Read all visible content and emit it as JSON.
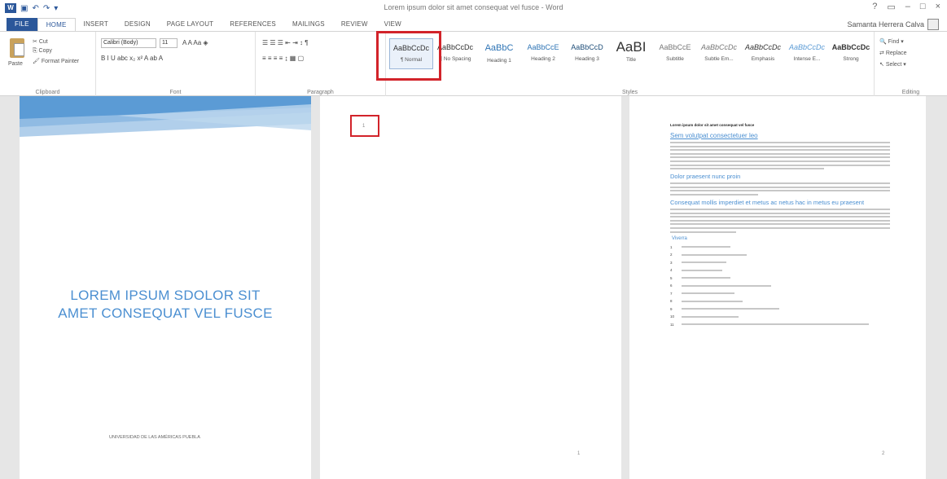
{
  "window": {
    "title": "Lorem ipsum dolor sit amet consequat vel fusce - Word",
    "controls": [
      "?",
      "▭",
      "–",
      "□",
      "×"
    ]
  },
  "qat": {
    "logo": "W",
    "save": "▣",
    "undo": "↶",
    "redo": "↷",
    "more": "▾"
  },
  "tabs": [
    "FILE",
    "HOME",
    "INSERT",
    "DESIGN",
    "PAGE LAYOUT",
    "REFERENCES",
    "MAILINGS",
    "REVIEW",
    "VIEW"
  ],
  "user": "Samanta Herrera Calva",
  "clipboard": {
    "paste": "Paste",
    "cut": "Cut",
    "copy": "Copy",
    "format_painter": "Format Painter",
    "label": "Clipboard"
  },
  "font": {
    "name": "Calibri (Body)",
    "size": "11",
    "row1": "A  A  Aa  ◈",
    "row2": "B  I  U  abc  x₂  x²   A  ab  A",
    "label": "Font"
  },
  "paragraph": {
    "row1": "☰  ☰  ☰   ⇤  ⇥   ↕  ¶",
    "row2": "≡  ≡  ≡  ≡   ↨   ▦  ▢",
    "label": "Paragraph"
  },
  "styles": {
    "items": [
      {
        "preview": "AaBbCcDc",
        "name": "¶ Normal"
      },
      {
        "preview": "AaBbCcDc",
        "name": "¶ No Spacing"
      },
      {
        "preview": "AaBbC",
        "name": "Heading 1"
      },
      {
        "preview": "AaBbCcE",
        "name": "Heading 2"
      },
      {
        "preview": "AaBbCcD",
        "name": "Heading 3"
      },
      {
        "preview": "AaBI",
        "name": "Title"
      },
      {
        "preview": "AaBbCcE",
        "name": "Subtitle"
      },
      {
        "preview": "AaBbCcDc",
        "name": "Subtle Em..."
      },
      {
        "preview": "AaBbCcDc",
        "name": "Emphasis"
      },
      {
        "preview": "AaBbCcDc",
        "name": "Intense E..."
      },
      {
        "preview": "AaBbCcDc",
        "name": "Strong"
      }
    ],
    "label": "Styles"
  },
  "editing": {
    "find": "Find",
    "replace": "Replace",
    "select": "Select",
    "label": "Editing"
  },
  "pages": {
    "cover_title": [
      "LOREM IPSUM SDOLOR SIT",
      "AMET CONSEQUAT VEL FUSCE"
    ],
    "cover_footer": "UNIVERSIDAD DE LAS AMÉRICAS PUEBLA",
    "page2_marker": "1",
    "page2_number": "1",
    "page3_number": "2",
    "p3_title": "Lorem ipsum dolor sit amet consequat vel fusce",
    "p3_heading1": "Sem volutpat consectetuer leo",
    "p3_heading2": "Dolor praesent nunc proin",
    "p3_heading3": "Consequat mollis imperdiet et metus ac netus hac in metus eu praesent",
    "p3_list_title": "Viverra"
  },
  "list_items": [
    "1",
    "2",
    "3",
    "4",
    "5",
    "6",
    "7",
    "8",
    "9",
    "10",
    "11"
  ]
}
